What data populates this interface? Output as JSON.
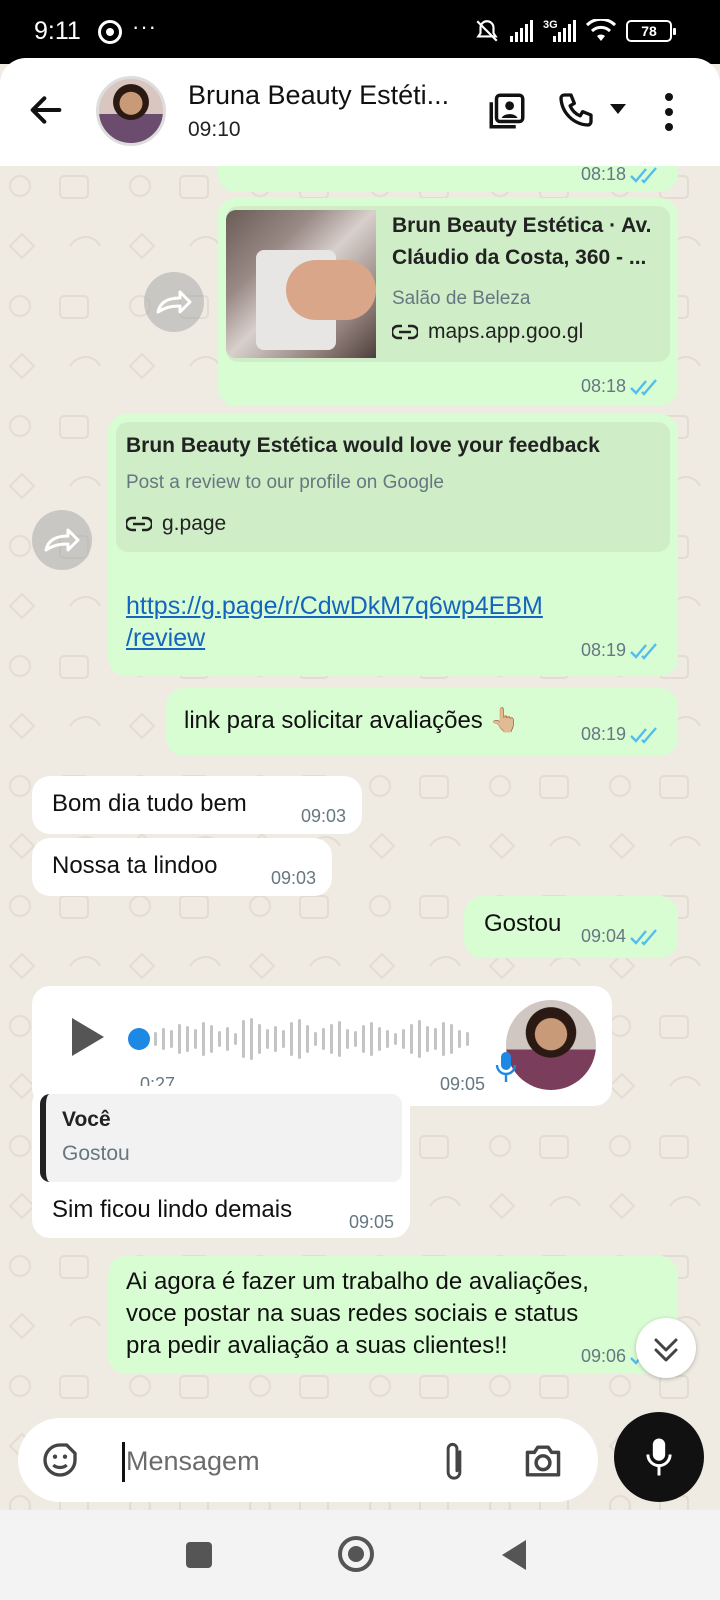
{
  "status_bar": {
    "time": "9:11",
    "battery": "78",
    "network": "3G"
  },
  "header": {
    "contact_name": "Bruna Beauty Estéti...",
    "subtitle": "09:10"
  },
  "messages": {
    "m1": {
      "time": "08:18"
    },
    "m2": {
      "card_title_line1": "Brun Beauty Estética · Av.",
      "card_title_line2": "Cláudio da Costa, 360 - ...",
      "card_category": "Salão de Beleza",
      "card_domain": "maps.app.goo.gl",
      "time": "08:18"
    },
    "m3": {
      "card_title": "Brun Beauty Estética would love your feedback",
      "card_desc": "Post a review to our profile on Google",
      "card_domain": "g.page",
      "url_line1": "https://g.page/r/CdwDkM7q6wp4EBM",
      "url_line2": "/review",
      "time": "08:19"
    },
    "m4": {
      "text": "link para solicitar avaliações 👆🏼",
      "time": "08:19"
    },
    "m5": {
      "text": "Bom dia tudo bem",
      "time": "09:03"
    },
    "m6": {
      "text": "Nossa ta lindoo",
      "time": "09:03"
    },
    "m7": {
      "text": "Gostou",
      "time": "09:04"
    },
    "m8": {
      "duration": "0:27",
      "time": "09:05",
      "played_fraction": 0.0
    },
    "m9": {
      "quote_author": "Você",
      "quote_text": "Gostou",
      "text": "Sim ficou lindo demais",
      "time": "09:05"
    },
    "m10": {
      "line1": "Ai agora é fazer um trabalho de avaliações,",
      "line2": "voce postar na suas redes sociais e status",
      "line3": "pra pedir avaliação a suas clientes!!",
      "time": "09:06"
    }
  },
  "composer": {
    "placeholder": "Mensagem"
  },
  "colors": {
    "outgoing": "#d9fdd3",
    "incoming": "#ffffff",
    "read_ticks": "#53bdeb",
    "link": "#1565c0"
  },
  "icons": [
    "back-arrow-icon",
    "contact-card-icon",
    "phone-icon",
    "dropdown-icon",
    "more-vertical-icon",
    "forward-icon",
    "link-icon",
    "read-ticks-icon",
    "play-icon",
    "mic-icon",
    "sticker-icon",
    "attach-icon",
    "camera-icon",
    "chevron-double-down-icon"
  ]
}
